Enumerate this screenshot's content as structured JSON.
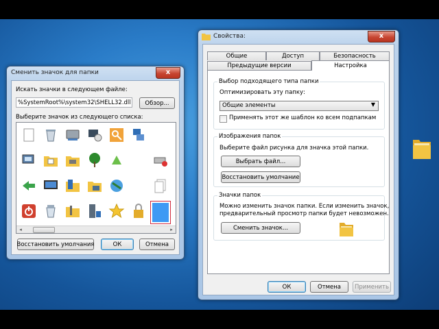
{
  "change_icon_dialog": {
    "title": "Сменить значок для папки",
    "close_label": "x",
    "search_label": "Искать значки в следующем файле:",
    "path_value": "%SystemRoot%\\system32\\SHELL32.dll",
    "browse_label": "Обзор...",
    "list_label": "Выберите значок из следующего списка:",
    "restore_defaults_label": "Восстановить умолчания",
    "ok_label": "ОК",
    "cancel_label": "Отмена",
    "icons": [
      "blank-document-icon",
      "recycle-bin-icon",
      "network-drive-icon",
      "monitor-disc-icon",
      "key-icon",
      "network-computers-icon",
      "",
      "computer-settings-icon",
      "folder-documents-icon",
      "printer-folder-icon",
      "tree-icon",
      "recycle-arrow-icon",
      "",
      "disk-error-icon",
      "arrow-green-icon",
      "monitor-screen-icon",
      "folder-files-icon",
      "folder-computer-icon",
      "globe-monitor-icon",
      "",
      "documents-stack-icon",
      "power-icon",
      "recycle-bin-full-icon",
      "tools-folder-icon",
      "server-icon",
      "star-icon",
      "lock-icon",
      "selected-blank-icon",
      "magnifier-icon"
    ]
  },
  "properties_dialog": {
    "title": "Свойства:",
    "close_label": "x",
    "tabs_row1": [
      "Общие",
      "Доступ",
      "Безопасность"
    ],
    "tabs_row2": [
      "Предыдущие версии",
      "Настройка"
    ],
    "group_type": {
      "title": "Выбор подходящего типа папки",
      "optimize_label": "Оптимизировать эту папку:",
      "select_value": "Общие элементы",
      "apply_label": "Применять этот же шаблон ко всем подпапкам",
      "apply_checked": false
    },
    "group_pictures": {
      "title": "Изображения папок",
      "desc": "Выберите файл рисунка для значка этой папки.",
      "choose_file_label": "Выбрать файл...",
      "restore_default_label": "Восстановить умолчание"
    },
    "group_icons": {
      "title": "Значки папок",
      "desc_line1": "Можно изменить значок папки. Если изменить значок,",
      "desc_line2": "предварительный просмотр папки будет невозможен.",
      "change_icon_label": "Сменить значок..."
    },
    "ok_label": "ОК",
    "cancel_label": "Отмена",
    "apply_button_label": "Применить"
  },
  "colors": {
    "accent": "#3c7fb1",
    "selection_border": "#d0293c",
    "close_red": "#c74632",
    "folder_yellow": "#f2c443"
  }
}
